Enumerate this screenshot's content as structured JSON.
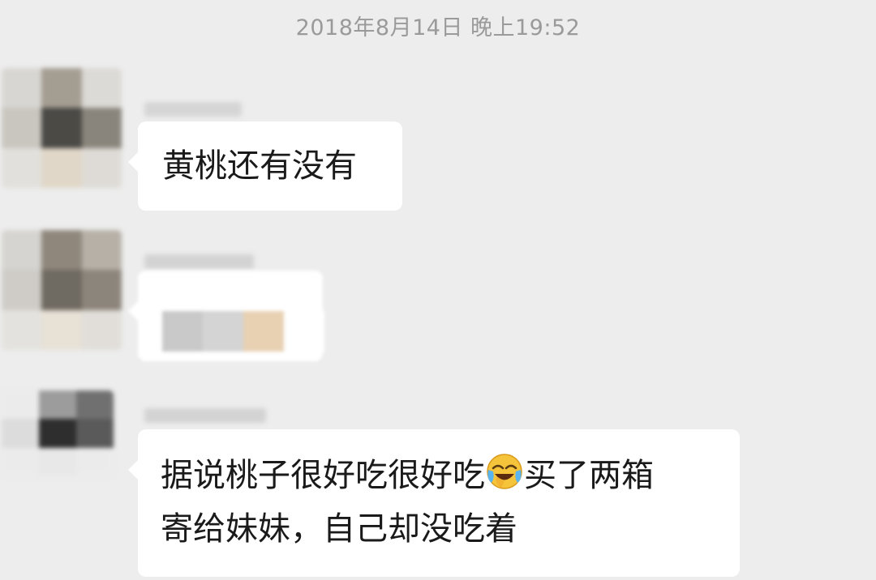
{
  "chat": {
    "timestamp": "2018年8月14日 晚上19:52",
    "messages": [
      {
        "type": "text",
        "text": "黄桃还有没有"
      },
      {
        "type": "image"
      },
      {
        "type": "text",
        "text_line1_a": "据说桃子很好吃很好吃",
        "emoji": "face-with-tears-of-joy",
        "text_line1_b": "买了两箱",
        "text_line2": "寄给妹妹，自己却没吃着"
      }
    ]
  },
  "colors": {
    "background": "#ededed",
    "bubble": "#ffffff",
    "timestamp": "#9a9a9a"
  }
}
